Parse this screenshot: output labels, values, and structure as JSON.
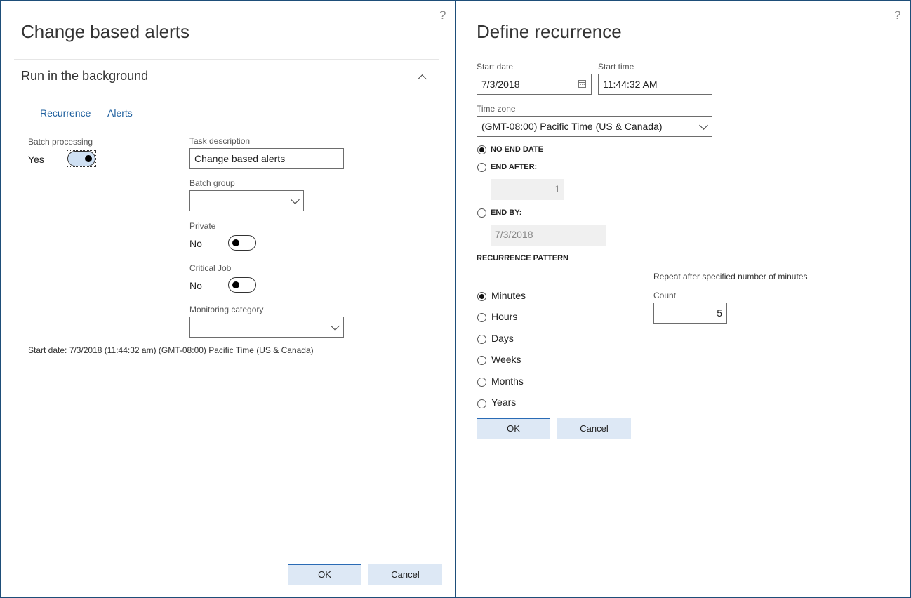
{
  "left": {
    "help": "?",
    "title": "Change based alerts",
    "section_title": "Run in the background",
    "tabs": [
      "Recurrence",
      "Alerts"
    ],
    "batch_processing": {
      "label": "Batch processing",
      "value": "Yes",
      "on": true
    },
    "task_description": {
      "label": "Task description",
      "value": "Change based alerts"
    },
    "batch_group": {
      "label": "Batch group",
      "value": ""
    },
    "private": {
      "label": "Private",
      "value": "No",
      "on": false
    },
    "critical_job": {
      "label": "Critical Job",
      "value": "No",
      "on": false
    },
    "monitoring_category": {
      "label": "Monitoring category",
      "value": ""
    },
    "start_summary": "Start date: 7/3/2018 (11:44:32 am) (GMT-08:00) Pacific Time (US & Canada)",
    "ok": "OK",
    "cancel": "Cancel"
  },
  "right": {
    "help": "?",
    "title": "Define recurrence",
    "start_date": {
      "label": "Start date",
      "value": "7/3/2018"
    },
    "start_time": {
      "label": "Start time",
      "value": "11:44:32 AM"
    },
    "time_zone": {
      "label": "Time zone",
      "value": "(GMT-08:00) Pacific Time (US & Canada)"
    },
    "end_options": {
      "no_end_date": "NO END DATE",
      "end_after": "END AFTER:",
      "end_after_value": "1",
      "end_by": "END BY:",
      "end_by_value": "7/3/2018",
      "selected": "no_end_date"
    },
    "recurrence_pattern": {
      "heading": "RECURRENCE PATTERN",
      "options": [
        "Minutes",
        "Hours",
        "Days",
        "Weeks",
        "Months",
        "Years"
      ],
      "selected": "Minutes",
      "description": "Repeat after specified number of minutes",
      "count_label": "Count",
      "count_value": "5"
    },
    "ok": "OK",
    "cancel": "Cancel"
  },
  "colors": {
    "accent": "#1e5f9e",
    "border": "#1e4e79",
    "button_bg": "#dde8f5"
  }
}
